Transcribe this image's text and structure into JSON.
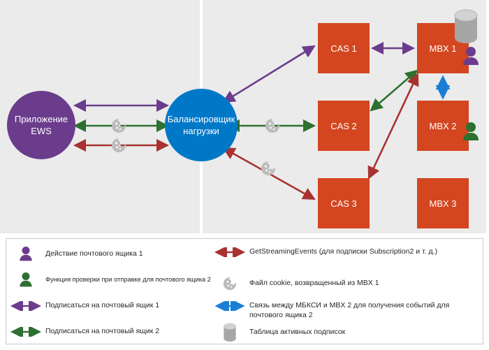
{
  "colors": {
    "background": "#ebebeb",
    "panel_divider": "#ffffff",
    "app_circle": "#6b3c8c",
    "loadbalancer_circle": "#0078c8",
    "server_box": "#d4461f",
    "purple_arrow": "#6b3c8c",
    "green_arrow": "#2d7030",
    "red_arrow": "#a83232",
    "blue_dotted_arrow": "#1a7fd4",
    "cookie_gray": "#bcbcbc",
    "cylinder_gray": "#a6a6a6",
    "person_purple": "#6b3c8c",
    "person_green": "#2d7030",
    "legend_border": "#c8c8c8",
    "legend_background": "#ffffff",
    "label_text": "#ffffff",
    "legend_text": "#262626"
  },
  "diagram": {
    "nodes": {
      "app": {
        "line1": "Приложение",
        "line2": "EWS"
      },
      "loadbalancer": {
        "line1": "Балансировщик",
        "line2": "нагрузки"
      },
      "cas1": "CAS 1",
      "cas2": "CAS 2",
      "cas3": "CAS 3",
      "mbx1": "MBX 1",
      "mbx2": "MBX 2",
      "mbx3": "MBX 3"
    },
    "icons": {
      "cookie": "cookie-icon",
      "cylinder": "database-cylinder-icon",
      "person_purple": "person-purple-icon",
      "person_green": "person-green-icon"
    },
    "connections": [
      {
        "id": "app-lb-purple",
        "from": "app",
        "to": "loadbalancer",
        "color": "#6b3c8c",
        "style": "double-arrow"
      },
      {
        "id": "app-lb-green",
        "from": "loadbalancer",
        "to": "app",
        "color": "#2d7030",
        "style": "double-arrow",
        "marker": "cookie"
      },
      {
        "id": "app-lb-red",
        "from": "loadbalancer",
        "to": "app",
        "color": "#a83232",
        "style": "double-arrow",
        "marker": "cookie"
      },
      {
        "id": "lb-cas1-purple",
        "from": "loadbalancer",
        "to": "cas1",
        "color": "#6b3c8c",
        "style": "double-arrow"
      },
      {
        "id": "lb-cas2-green",
        "from": "loadbalancer",
        "to": "cas2",
        "color": "#2d7030",
        "style": "double-arrow",
        "marker": "cookie"
      },
      {
        "id": "lb-cas3-red",
        "from": "loadbalancer",
        "to": "cas3",
        "color": "#a83232",
        "style": "double-arrow",
        "marker": "cookie"
      },
      {
        "id": "cas1-mbx1-purple",
        "from": "cas1",
        "to": "mbx1",
        "color": "#6b3c8c",
        "style": "double-arrow"
      },
      {
        "id": "cas2-mbx1-green",
        "from": "cas2",
        "to": "mbx1",
        "color": "#2d7030",
        "style": "double-arrow"
      },
      {
        "id": "cas3-mbx1-red",
        "from": "cas3",
        "to": "mbx1",
        "color": "#a83232",
        "style": "double-arrow"
      },
      {
        "id": "mbx1-mbx2-blue",
        "from": "mbx1",
        "to": "mbx2",
        "color": "#1a7fd4",
        "style": "dotted-double-arrow"
      }
    ]
  },
  "legend": {
    "left": [
      {
        "icon": "person-purple-icon",
        "label": "Действие почтового ящика 1"
      },
      {
        "icon": "person-green-icon",
        "label": "Функция проверки при отправке для почтового ящика 2"
      },
      {
        "icon": "purple-double-arrow-icon",
        "label": "Подписаться на почтовый ящик 1"
      },
      {
        "icon": "green-double-arrow-icon",
        "label": "Подписаться на почтовый ящик 2"
      }
    ],
    "right": [
      {
        "icon": "red-double-arrow-icon",
        "label": "GetStreamingEvents (для подписки Subscription2 и т. д.)"
      },
      {
        "icon": "cookie-icon",
        "label": "Файл cookie, возвращенный из MBX 1"
      },
      {
        "icon": "blue-dotted-double-arrow-icon",
        "label": "Связь между МБКСИ и MBX 2 для получения событий для почтового ящика 2"
      },
      {
        "icon": "database-cylinder-icon",
        "label": "Таблица активных подписок"
      }
    ]
  }
}
